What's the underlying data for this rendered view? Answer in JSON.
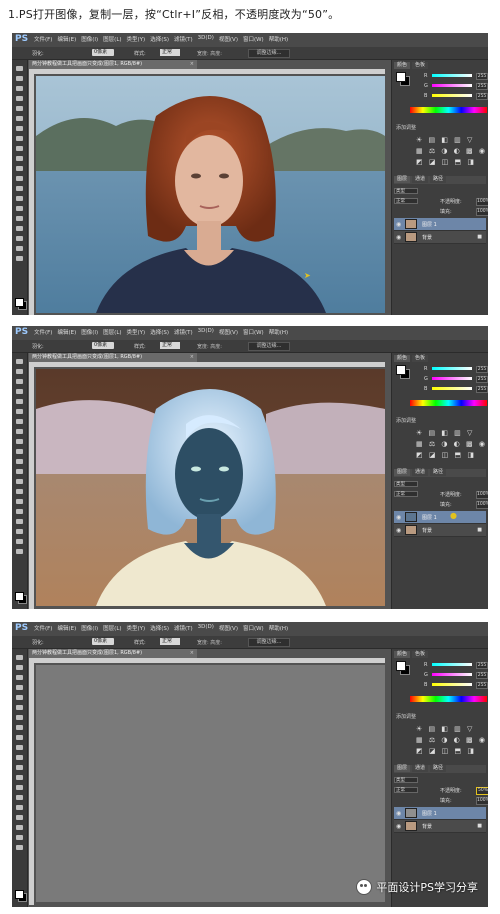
{
  "caption": "1.PS打开图像，复制一层，按“Ctlr+I”反相，不透明度改为“50”。",
  "ps_app": {
    "logo": "PS",
    "menu": [
      "文件(F)",
      "编辑(E)",
      "图像(I)",
      "图层(L)",
      "类型(Y)",
      "选择(S)",
      "滤镜(T)",
      "3D(D)",
      "视图(V)",
      "窗口(W)",
      "帮助(H)"
    ],
    "options": {
      "feather_label": "羽化:",
      "feather_value": "0像素",
      "style_label": "样式:",
      "style_value": "正常",
      "wh_label": "宽度:  高度:",
      "refine_edge": "调整边缘..."
    },
    "doc_tab": "两分钟教程做工具把画面只变成(图层1, RGB/8#)"
  },
  "color_panel": {
    "tabs": [
      "颜色",
      "色板"
    ],
    "labels": [
      "R",
      "G",
      "B"
    ],
    "values": [
      "255",
      "255",
      "255"
    ]
  },
  "adjustments": {
    "title": "添加调整",
    "row1": "☀ ▤ ◧ ▥ ▽",
    "row2": "▦ ⚖ ◑ ◐ ▩ ◉",
    "row3": "◩ ◪ ◫ ⬒ ◨"
  },
  "layers_panel": {
    "tabs": [
      "图层",
      "通道",
      "路径"
    ],
    "kind": "类型",
    "mode": "正常",
    "opacity_label": "不透明度:",
    "fill_label": "填充:",
    "fill_value": "100%",
    "screens": [
      {
        "opacity": "100%",
        "top_layer": "图层 1",
        "bottom_layer": "背景",
        "top_thumb": "#b99a80"
      },
      {
        "opacity": "100%",
        "top_layer": "图层 1",
        "bottom_layer": "背景",
        "top_thumb": "#5c7590"
      },
      {
        "opacity": "50%",
        "top_layer": "图层 1",
        "bottom_layer": "背景",
        "top_thumb": "#8f8f8f"
      }
    ]
  },
  "watermark": "平面设计PS学习分享",
  "colors": {
    "ui_dark": "#535353",
    "selected_layer": "#6d86a8",
    "gray_canvas": "#7a7a7a"
  }
}
